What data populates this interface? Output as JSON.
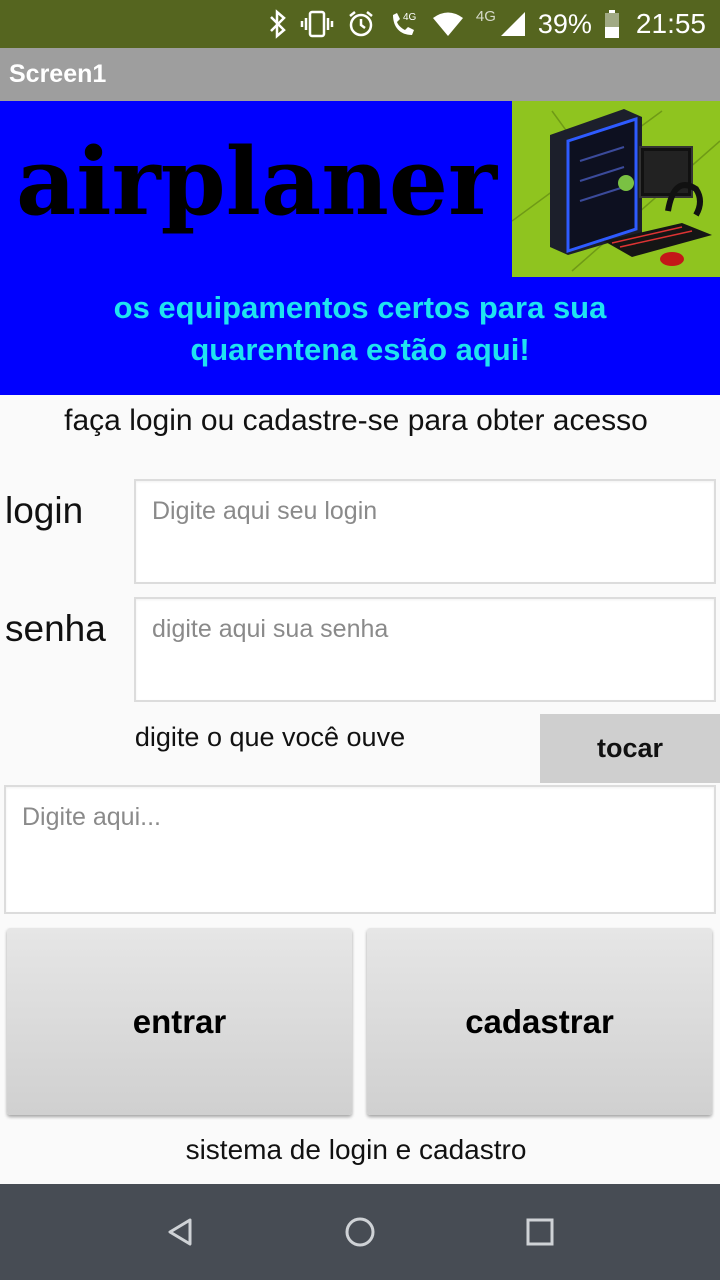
{
  "status_bar": {
    "network": "4G",
    "battery_percent": "39%",
    "time": "21:55",
    "icons": [
      "bluetooth-icon",
      "vibrate-icon",
      "alarm-icon",
      "volte-call-icon",
      "wifi-icon",
      "signal-icon",
      "battery-icon"
    ]
  },
  "app_bar": {
    "title": "Screen1"
  },
  "banner": {
    "brand": "airplaner",
    "tagline_line1": "os equipamentos certos para sua",
    "tagline_line2": "quarentena estão aqui!",
    "image": "computer-setup-image",
    "colors": {
      "background": "#0000ff",
      "tagline": "#1fe3f0",
      "image_bg": "#8fc41f"
    }
  },
  "instructions": "faça login ou cadastre-se para obter acesso",
  "form": {
    "login_label": "login",
    "login_placeholder": "Digite aqui seu login",
    "password_label": "senha",
    "password_placeholder": "digite aqui sua senha"
  },
  "captcha": {
    "prompt": "digite o que você ouve",
    "play_button": "tocar",
    "input_placeholder": "Digite aqui..."
  },
  "actions": {
    "enter": "entrar",
    "register": "cadastrar"
  },
  "footer": "sistema de login e cadastro",
  "nav": [
    "back-icon",
    "home-icon",
    "recents-icon"
  ]
}
